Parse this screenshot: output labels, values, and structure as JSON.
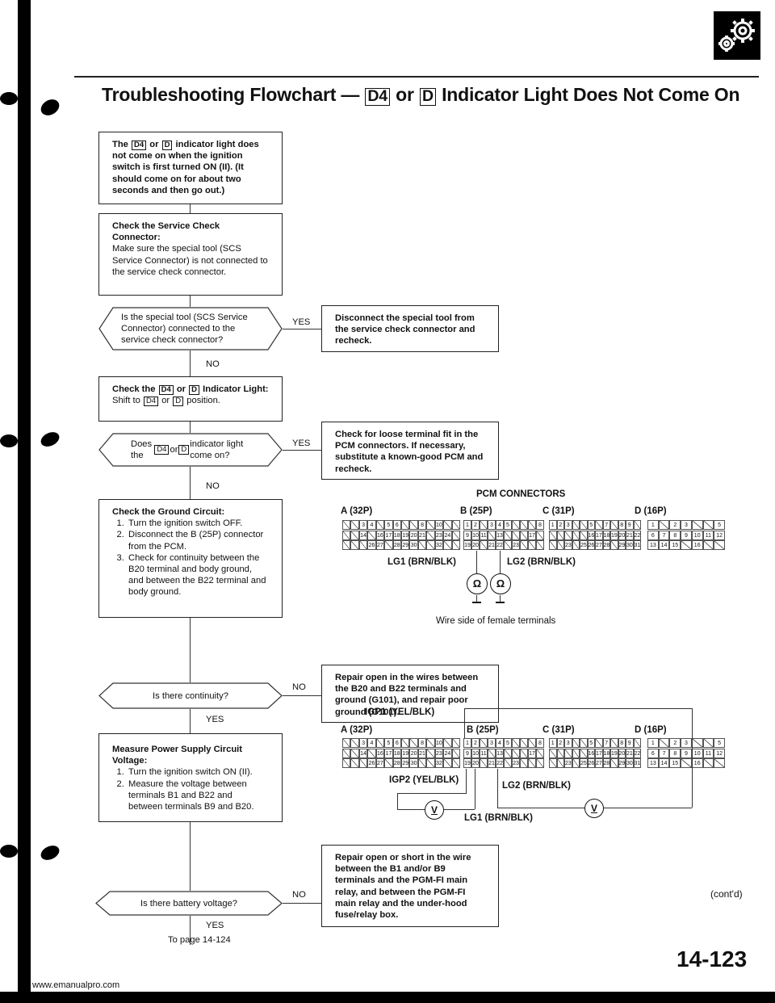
{
  "page": {
    "title_prefix": "Troubleshooting Flowchart —",
    "title_key1": "D4",
    "title_mid": "or",
    "title_key2": "D",
    "title_suffix": "Indicator Light Does Not Come On",
    "logo_icon": "gears-icon",
    "page_number": "14-123",
    "contd": "(cont'd)",
    "footer_url": "www.emanualpro.com"
  },
  "flow": {
    "start": {
      "text": "The [D4] or [D] indicator light does not come on when the ignition switch is first turned ON (II). (It should come on for about two seconds and then go out.)"
    },
    "step1": {
      "heading": "Check the Service Check Connector:",
      "body": "Make sure the special tool (SCS Service Connector) is not connected to the service check connector."
    },
    "q1": {
      "text": "Is the special tool (SCS Service Connector) connected to the service check connector?",
      "yes": "YES",
      "no": "NO",
      "yes_action": "Disconnect the special tool from the service check connector and recheck."
    },
    "step2": {
      "heading": "Check the [D4] or [D] Indicator Light:",
      "body": "Shift to [D4] or [D] position."
    },
    "q2": {
      "text": "Does the [D4] or [D] indicator light come on?",
      "yes": "YES",
      "no": "NO",
      "yes_action": "Check for loose terminal fit in the PCM connectors. If necessary, substitute a known-good PCM and recheck."
    },
    "step3": {
      "heading": "Check the Ground Circuit:",
      "items": [
        "Turn the ignition switch OFF.",
        "Disconnect the B (25P) connector from the PCM.",
        "Check for continuity between the B20 terminal and body ground, and between the B22 terminal and body ground."
      ]
    },
    "q3": {
      "text": "Is there continuity?",
      "yes": "YES",
      "no": "NO",
      "no_action": "Repair open in the wires between the B20 and B22 terminals and ground (G101), and repair poor ground (G101)."
    },
    "step4": {
      "heading": "Measure Power Supply Circuit Voltage:",
      "items": [
        "Turn the ignition switch ON (II).",
        "Measure the voltage between terminals B1 and B22 and between terminals B9 and B20."
      ]
    },
    "q4": {
      "text": "Is there battery voltage?",
      "yes": "YES",
      "no": "NO",
      "no_action": "Repair open or short in the wire between the B1 and/or B9 terminals and the PGM-FI main relay, and between the PGM-FI main relay and the under-hood fuse/relay box."
    },
    "next": "To page 14-124"
  },
  "diagram1": {
    "title": "PCM CONNECTORS",
    "connectors": [
      "A (32P)",
      "B (25P)",
      "C (31P)",
      "D (16P)"
    ],
    "wire1": "LG1 (BRN/BLK)",
    "wire2": "LG2 (BRN/BLK)",
    "meter_symbol": "Ω",
    "caption": "Wire side of female terminals"
  },
  "diagram2": {
    "connectors": [
      "A (32P)",
      "B (25P)",
      "C (31P)",
      "D (16P)"
    ],
    "igp1": "IGP1 (YEL/BLK)",
    "igp2": "IGP2 (YEL/BLK)",
    "lg1": "LG1 (BRN/BLK)",
    "lg2": "LG2 (BRN/BLK)",
    "meter_symbol": "V"
  },
  "pins": {
    "A": [
      [
        "",
        "",
        "3",
        "4",
        "",
        "5",
        "6",
        "",
        "",
        "8",
        "",
        "10",
        "",
        ""
      ],
      [
        "",
        "",
        "14",
        "",
        "16",
        "17",
        "18",
        "19",
        "20",
        "21",
        "",
        "23",
        "24",
        ""
      ],
      [
        "",
        "",
        "",
        "26",
        "27",
        "",
        "28",
        "29",
        "30",
        "",
        "",
        "32",
        "",
        ""
      ]
    ],
    "B": [
      [
        "1",
        "2",
        "",
        "3",
        "4",
        "5",
        "",
        "",
        "",
        "8"
      ],
      [
        "9",
        "10",
        "11",
        "",
        "13",
        "",
        "",
        "",
        "17",
        ""
      ],
      [
        "19",
        "20",
        "",
        "21",
        "22",
        "",
        "23",
        "",
        "",
        ""
      ]
    ],
    "C": [
      [
        "1",
        "2",
        "3",
        "",
        "",
        "5",
        "",
        "7",
        "",
        "8",
        "9",
        ""
      ],
      [
        "",
        "",
        "",
        "",
        "",
        "16",
        "17",
        "18",
        "19",
        "20",
        "21",
        "22"
      ],
      [
        "",
        "",
        "23",
        "",
        "25",
        "26",
        "27",
        "28",
        "",
        "29",
        "30",
        "31"
      ]
    ],
    "D": [
      [
        "1",
        "",
        "2",
        "3",
        "",
        "",
        "5"
      ],
      [
        "6",
        "7",
        "8",
        "9",
        "10",
        "11",
        "12"
      ],
      [
        "13",
        "14",
        "15",
        "",
        "16",
        "",
        ""
      ]
    ]
  }
}
